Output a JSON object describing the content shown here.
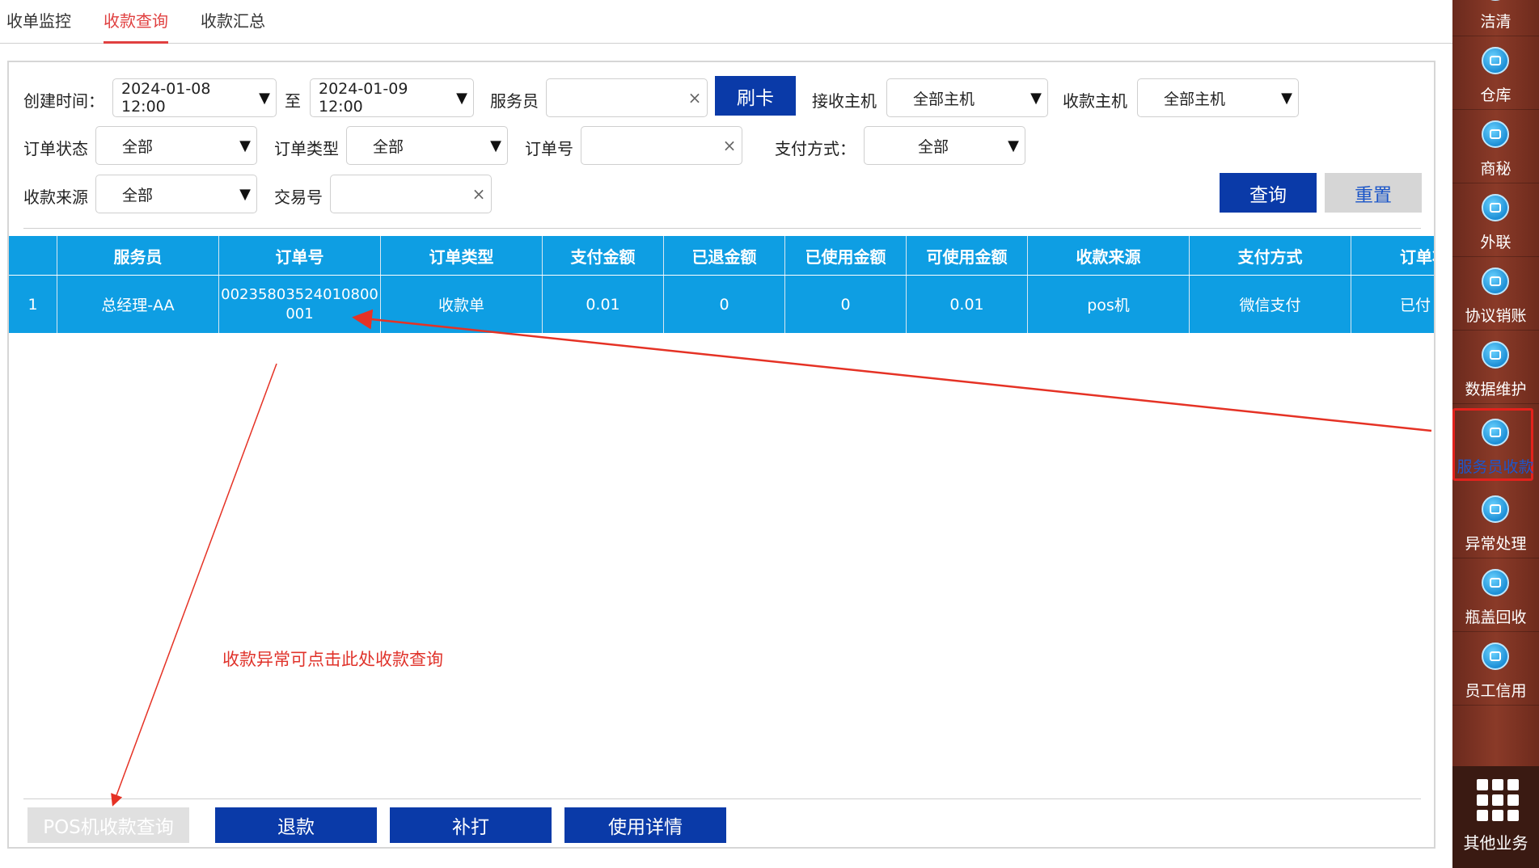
{
  "tabs": [
    {
      "label": "收单监控"
    },
    {
      "label": "收款查询",
      "active": true
    },
    {
      "label": "收款汇总"
    }
  ],
  "filters": {
    "create_time_label": "创建时间：",
    "start_time": "2024-01-08 12:00",
    "to_label": "至",
    "end_time": "2024-01-09 12:00",
    "waiter_label": "服务员",
    "waiter_value": "",
    "swipe_card": "刷卡",
    "receive_host_label": "接收主机",
    "receive_host_value": "全部主机",
    "collect_host_label": "收款主机",
    "collect_host_value": "全部主机",
    "order_status_label": "订单状态",
    "order_status_value": "全部",
    "order_type_label": "订单类型",
    "order_type_value": "全部",
    "order_no_label": "订单号",
    "order_no_value": "",
    "pay_method_label": "支付方式：",
    "pay_method_value": "全部",
    "source_label": "收款来源",
    "source_value": "全部",
    "trade_no_label": "交易号",
    "trade_no_value": "",
    "query": "查询",
    "reset": "重置",
    "clear_glyph": "×",
    "dropdown_glyph": "▼"
  },
  "table": {
    "columns": [
      "",
      "服务员",
      "订单号",
      "订单类型",
      "支付金额",
      "已退金额",
      "已使用金额",
      "可使用金额",
      "收款来源",
      "支付方式",
      "订单状"
    ],
    "rows": [
      [
        "1",
        "总经理-AA",
        "00235803524010800001",
        "收款单",
        "0.01",
        "0",
        "0",
        "0.01",
        "pos机",
        "微信支付",
        "已付"
      ]
    ]
  },
  "annotation": "收款异常可点击此处收款查询",
  "actions": {
    "pos_query": "POS机收款查询",
    "refund": "退款",
    "reprint": "补打",
    "usage_detail": "使用详情"
  },
  "sidebar": {
    "items": [
      {
        "label": "洁清",
        "icon": "cleaning-icon"
      },
      {
        "label": "仓库",
        "icon": "warehouse-icon"
      },
      {
        "label": "商秘",
        "icon": "download-icon"
      },
      {
        "label": "外联",
        "icon": "contact-icon"
      },
      {
        "label": "协议销账",
        "icon": "download-icon"
      },
      {
        "label": "数据维护",
        "icon": "pie-chart-icon"
      },
      {
        "label": "服务员收款",
        "icon": "person-icon",
        "highlighted": true
      },
      {
        "label": "异常处理",
        "icon": "box-icon"
      },
      {
        "label": "瓶盖回收",
        "icon": "recycle-icon"
      },
      {
        "label": "员工信用",
        "icon": "credit-icon"
      }
    ],
    "more_label": "其他业务"
  },
  "colors": {
    "accent": "#0a3aa8",
    "table_header": "#0e9ee3",
    "active_tab": "#e04040",
    "annotation": "#e0332b",
    "sidebar": "#7a3322"
  }
}
